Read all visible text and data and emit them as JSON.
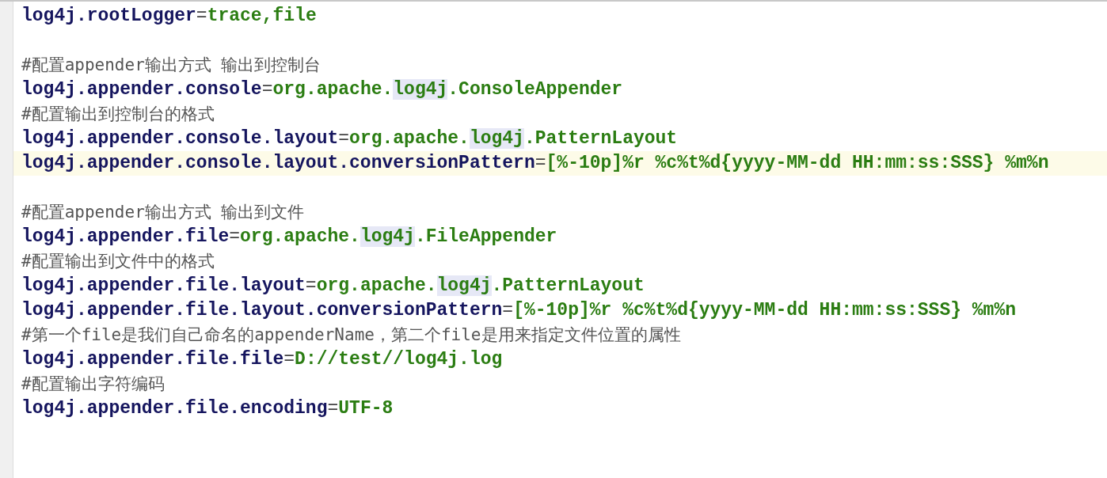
{
  "editor": {
    "lines": [
      {
        "kind": "property",
        "key": "log4j.rootLogger",
        "separator": "=",
        "value": [
          {
            "text": "trace,file",
            "highlighted": false
          }
        ]
      },
      {
        "kind": "blank"
      },
      {
        "kind": "comment",
        "text": "#配置appender输出方式 输出到控制台"
      },
      {
        "kind": "property",
        "key": "log4j.appender.console",
        "separator": "=",
        "value": [
          {
            "text": "org.apache.",
            "highlighted": false
          },
          {
            "text": "log4j",
            "highlighted": true
          },
          {
            "text": ".ConsoleAppender",
            "highlighted": false
          }
        ]
      },
      {
        "kind": "comment",
        "text": "#配置输出到控制台的格式"
      },
      {
        "kind": "property",
        "key": "log4j.appender.console.layout",
        "separator": "=",
        "value": [
          {
            "text": "org.apache.",
            "highlighted": false
          },
          {
            "text": "log4j",
            "highlighted": true
          },
          {
            "text": ".PatternLayout",
            "highlighted": false
          }
        ]
      },
      {
        "kind": "property",
        "current": true,
        "key": "log4j.appender.console.layout.conversionPattern",
        "separator": "=",
        "value": [
          {
            "text": "[%-10p]%r %c%t%d{yyyy-MM-dd HH:mm:ss:SSS} %m%n",
            "highlighted": false
          }
        ]
      },
      {
        "kind": "blank"
      },
      {
        "kind": "comment",
        "text": "#配置appender输出方式 输出到文件"
      },
      {
        "kind": "property",
        "key": "log4j.appender.file",
        "separator": "=",
        "value": [
          {
            "text": "org.apache.",
            "highlighted": false
          },
          {
            "text": "log4j",
            "highlighted": true
          },
          {
            "text": ".FileAppender",
            "highlighted": false
          }
        ]
      },
      {
        "kind": "comment",
        "text": "#配置输出到文件中的格式"
      },
      {
        "kind": "property",
        "key": "log4j.appender.file.layout",
        "separator": "=",
        "value": [
          {
            "text": "org.apache.",
            "highlighted": false
          },
          {
            "text": "log4j",
            "highlighted": true
          },
          {
            "text": ".PatternLayout",
            "highlighted": false
          }
        ]
      },
      {
        "kind": "property",
        "key": "log4j.appender.file.layout.conversionPattern",
        "separator": "=",
        "value": [
          {
            "text": "[%-10p]%r %c%t%d{yyyy-MM-dd HH:mm:ss:SSS} %m%n",
            "highlighted": false
          }
        ]
      },
      {
        "kind": "comment",
        "text": "#第一个file是我们自己命名的appenderName，第二个file是用来指定文件位置的属性"
      },
      {
        "kind": "property",
        "key": "log4j.appender.file.file",
        "separator": "=",
        "value": [
          {
            "text": "D://test//log4j.log",
            "highlighted": false
          }
        ]
      },
      {
        "kind": "comment",
        "text": "#配置输出字符编码"
      },
      {
        "kind": "property",
        "key": "log4j.appender.file.encoding",
        "separator": "=",
        "value": [
          {
            "text": "UTF-8",
            "highlighted": false
          }
        ]
      }
    ]
  }
}
